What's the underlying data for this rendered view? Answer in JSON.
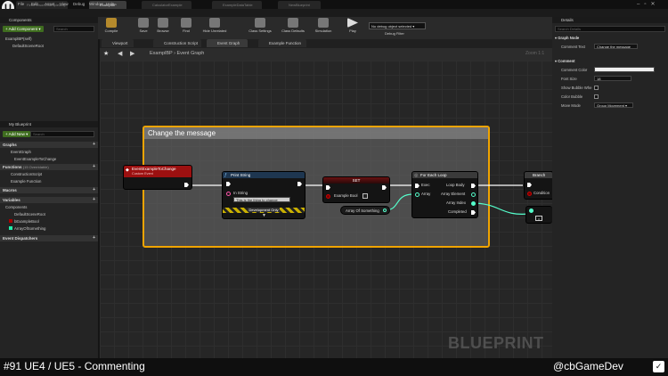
{
  "colors": {
    "accent": "#f0a400",
    "event_header": "#9c1010",
    "function_header": "#2a4a6a",
    "exec_pin": "#ffffff",
    "data_pin": "#5fc",
    "print_header": "#1e3650",
    "comment_fill": "#707070"
  },
  "tabs": [
    "FirstPersonExampleMap",
    "ExamplBP",
    "CalculatorExample",
    "ExampleDataTable",
    "NewBlueprint"
  ],
  "window_controls": [
    "Parent class:",
    "Actor"
  ],
  "menu": [
    "File",
    "Edit",
    "Asset",
    "View",
    "Debug",
    "Window",
    "Help"
  ],
  "toolbar": [
    {
      "label": "Compile",
      "icon": "compile-icon"
    },
    {
      "label": "Save",
      "icon": "save-icon"
    },
    {
      "label": "Browse",
      "icon": "browse-icon"
    },
    {
      "label": "Find",
      "icon": "find-icon"
    },
    {
      "label": "Hide Unrelated",
      "icon": "hide-unrelated-icon"
    },
    {
      "label": "Class Settings",
      "icon": "class-settings-icon"
    },
    {
      "label": "Class Defaults",
      "icon": "class-defaults-icon"
    },
    {
      "label": "Simulation",
      "icon": "simulation-icon"
    },
    {
      "label": "Play",
      "icon": "play-icon"
    }
  ],
  "debug_filter": {
    "value": "No debug object selected ▾",
    "label": "Debug Filter"
  },
  "components_panel": {
    "title": "Components",
    "add_button": "+ Add Component ▾",
    "search_placeholder": "Search",
    "items": [
      "ExamplBP(self)",
      "DefaultSceneRoot"
    ]
  },
  "my_blueprint": {
    "title": "My Blueprint",
    "add_button": "+ Add New ▾",
    "search_placeholder": "Search",
    "sections": [
      {
        "name": "Graphs",
        "items": [
          "EventGraph",
          "EventExampleToChange"
        ]
      },
      {
        "name": "Functions",
        "note": "(15 Overridable)",
        "items": [
          "ConstructionScript",
          "Example Function"
        ]
      },
      {
        "name": "Macros",
        "items": []
      },
      {
        "name": "Variables",
        "items": [
          "Components",
          "DefaultSceneRoot",
          "bExampleBool",
          "ArrayOfSomething"
        ]
      },
      {
        "name": "Event Dispatchers",
        "items": []
      }
    ]
  },
  "graph_tabs": [
    "Viewport",
    "Construction Script",
    "Event Graph",
    "Example Function"
  ],
  "breadcrumb": {
    "root": "ExamplBP",
    "sep": "›",
    "current": "Event Graph",
    "zoom": "Zoom 1:1"
  },
  "comment_box": {
    "title": "Change the message"
  },
  "nodes": {
    "event": {
      "title": "EventExampleToChange",
      "subtitle": "Custom Event"
    },
    "print": {
      "title": "Print String",
      "pin_label": "In String",
      "pin_value": "This is the thing to change",
      "footer": "Development Only"
    },
    "set": {
      "title": "SET",
      "pin": "Example Bool"
    },
    "array_get": {
      "label": "Array Of Something"
    },
    "foreach": {
      "title": "For Each Loop",
      "pins_in": [
        "Exec",
        "Array"
      ],
      "pins_out": [
        "Loop Body",
        "Array Element",
        "Array Index",
        "Completed"
      ]
    },
    "branch": {
      "title": "Branch",
      "pin": "Condition"
    }
  },
  "watermark": "BLUEPRINT",
  "details": {
    "title": "Details",
    "search_placeholder": "Search Details",
    "graph_node_section": "Graph Node",
    "comment_text_label": "Comment Text",
    "comment_text_value": "Change the message",
    "comment_section": "Comment",
    "rows": [
      {
        "label": "Comment Color",
        "value": ""
      },
      {
        "label": "Font Size",
        "value": "18"
      },
      {
        "label": "Show Bubble Whe",
        "value": ""
      },
      {
        "label": "Color Bubble",
        "value": ""
      },
      {
        "label": "Move Mode",
        "value": "Group Movement ▾"
      }
    ]
  },
  "bottom": {
    "left": "#91 UE4 / UE5 - Commenting",
    "right": "@cbGameDev"
  }
}
